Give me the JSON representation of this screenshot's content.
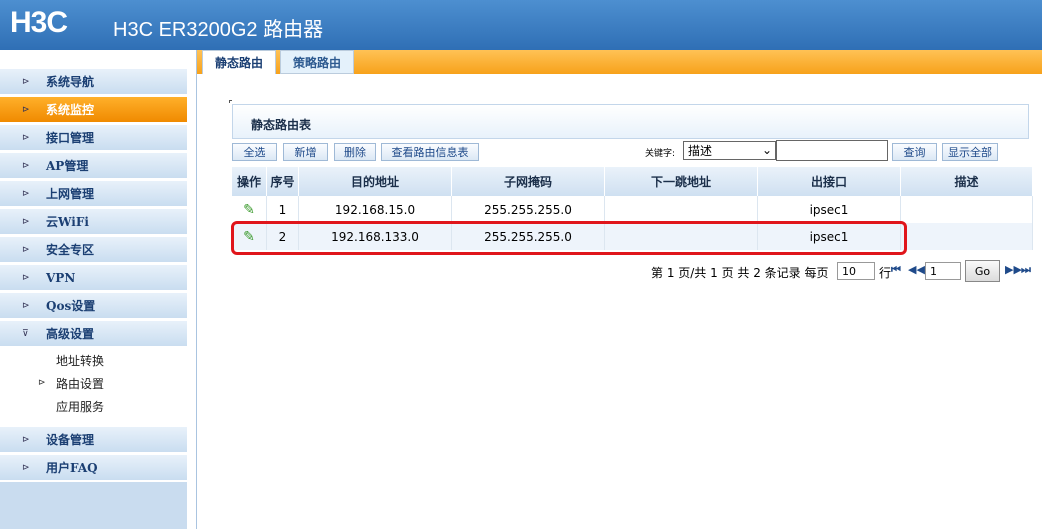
{
  "header": {
    "logo": "H3C",
    "title": "H3C ER3200G2 路由器"
  },
  "sidebar": {
    "items": [
      {
        "label": "系统导航",
        "arrow": "⊳"
      },
      {
        "label": "系统监控",
        "arrow": "⊳"
      },
      {
        "label": "接口管理",
        "arrow": "⊳"
      },
      {
        "label": "AP管理",
        "arrow": "⊳"
      },
      {
        "label": "上网管理",
        "arrow": "⊳"
      },
      {
        "label": "云WiFi",
        "arrow": "⊳"
      },
      {
        "label": "安全专区",
        "arrow": "⊳"
      },
      {
        "label": "VPN",
        "arrow": "⊳"
      },
      {
        "label": "Qos设置",
        "arrow": "⊳"
      },
      {
        "label": "高级设置",
        "arrow": "⊽"
      },
      {
        "label": "设备管理",
        "arrow": "⊳"
      },
      {
        "label": "用户FAQ",
        "arrow": "⊳"
      }
    ],
    "subitems": [
      {
        "label": "地址转换",
        "arrow": ""
      },
      {
        "label": "路由设置",
        "arrow": "⊳"
      },
      {
        "label": "应用服务",
        "arrow": ""
      }
    ],
    "active_color": "#f39300"
  },
  "tabs": {
    "active": "静态路由",
    "inactive": "策略路由"
  },
  "section": {
    "title": "静态路由表"
  },
  "toolbar": {
    "select_all": "全选",
    "add": "新增",
    "delete": "删除",
    "view_table": "查看路由信息表",
    "keyword_label": "关键字:",
    "keyword_value": "描述",
    "keyword_input": "",
    "search": "查询",
    "show_all": "显示全部"
  },
  "table": {
    "columns": [
      "操作",
      "序号",
      "目的地址",
      "子网掩码",
      "下一跳地址",
      "出接口",
      "描述"
    ],
    "rows": [
      {
        "index": "1",
        "dest": "192.168.15.0",
        "mask": "255.255.255.0",
        "next_hop": "",
        "iface": "ipsec1",
        "desc": ""
      },
      {
        "index": "2",
        "dest": "192.168.133.0",
        "mask": "255.255.255.0",
        "next_hop": "",
        "iface": "ipsec1",
        "desc": ""
      }
    ]
  },
  "pager": {
    "summary": "第 1 页/共 1 页 共 2 条记录 每页",
    "per_page": "10",
    "row_unit": "行",
    "page": "1",
    "go": "Go",
    "first": "⏮",
    "prev": "◀◀",
    "next": "▶▶",
    "last": "⏭"
  },
  "highlight_color": "#e0151b"
}
